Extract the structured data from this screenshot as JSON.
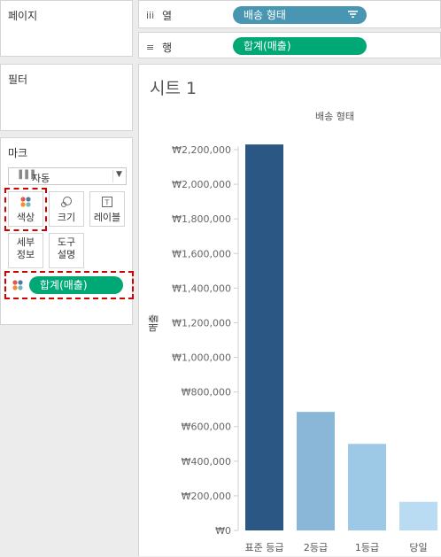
{
  "panels": {
    "pages_title": "페이지",
    "filters_title": "필터",
    "marks_title": "마크"
  },
  "shelves": {
    "columns": {
      "label": "열",
      "icon": "iii",
      "pill": "배송 형태",
      "pill_color": "#4996b2",
      "sort_icon": "sort-descending-icon"
    },
    "rows": {
      "label": "행",
      "icon": "≡",
      "pill": "합계(매출)",
      "pill_color": "#00a876"
    }
  },
  "marks": {
    "type_dropdown": "자동",
    "buttons": {
      "color": "색상",
      "size": "크기",
      "label": "레이블",
      "detail": [
        "세부",
        "정보"
      ],
      "tooltip": [
        "도구",
        "설명"
      ]
    },
    "color_pill": "합계(매출)",
    "color_pill_color": "#00a876",
    "highlight_color": "#d30000"
  },
  "sheet": {
    "title": "시트 1"
  },
  "chart_data": {
    "type": "bar",
    "header": "배송 형태",
    "ylabel": "매출",
    "categories": [
      "표준 등급",
      "2등급",
      "1등급",
      "당일"
    ],
    "values": [
      2230000,
      685000,
      500000,
      165000
    ],
    "colors": [
      "#2a5783",
      "#8ab6d8",
      "#9dc8e6",
      "#b9dcf2"
    ],
    "ylim": [
      0,
      2200000
    ],
    "yticks": [
      0,
      200000,
      400000,
      600000,
      800000,
      1000000,
      1200000,
      1400000,
      1600000,
      1800000,
      2000000,
      2200000
    ],
    "ytick_labels": [
      "₩0",
      "₩200,000",
      "₩400,000",
      "₩600,000",
      "₩800,000",
      "₩1,000,000",
      "₩1,200,000",
      "₩1,400,000",
      "₩1,600,000",
      "₩1,800,000",
      "₩2,000,000",
      "₩2,200,000"
    ],
    "grid": false
  }
}
